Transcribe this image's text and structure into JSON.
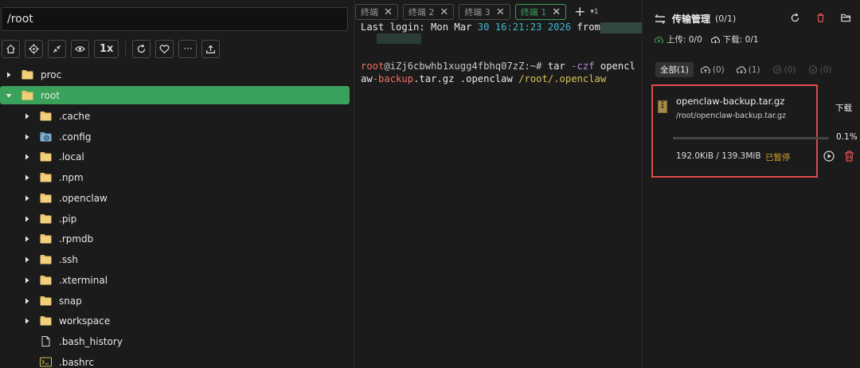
{
  "explorer": {
    "path_value": "/root",
    "zoom_label": "1x",
    "more_label": "···",
    "items": [
      {
        "name": "proc",
        "type": "folder",
        "expanded": false,
        "depth": 0
      },
      {
        "name": "root",
        "type": "folder",
        "expanded": true,
        "depth": 0,
        "selected": true
      },
      {
        "name": ".cache",
        "type": "folder",
        "depth": 1
      },
      {
        "name": ".config",
        "type": "folder-gear",
        "depth": 1
      },
      {
        "name": ".local",
        "type": "folder",
        "depth": 1
      },
      {
        "name": ".npm",
        "type": "folder",
        "depth": 1
      },
      {
        "name": ".openclaw",
        "type": "folder",
        "depth": 1
      },
      {
        "name": ".pip",
        "type": "folder",
        "depth": 1
      },
      {
        "name": ".rpmdb",
        "type": "folder",
        "depth": 1
      },
      {
        "name": ".ssh",
        "type": "folder",
        "depth": 1
      },
      {
        "name": ".xterminal",
        "type": "folder",
        "depth": 1
      },
      {
        "name": "snap",
        "type": "folder",
        "depth": 1
      },
      {
        "name": "workspace",
        "type": "folder",
        "depth": 1
      },
      {
        "name": ".bash_history",
        "type": "file",
        "depth": 1
      },
      {
        "name": ".bashrc",
        "type": "file-terminal",
        "depth": 1
      }
    ]
  },
  "terminal": {
    "tabs": [
      {
        "label": "终端 2",
        "active": false
      },
      {
        "label": "终端 3",
        "active": false
      },
      {
        "label": "终端 1",
        "active": true
      }
    ],
    "partial_tab_label": "终端",
    "tab_count_label": "1",
    "lines": {
      "login_prefix": "Last login: Mon Mar ",
      "login_day": "30",
      "login_time": "16:21:23",
      "login_year": "2026",
      "login_from": " from",
      "prompt_user": "root",
      "prompt_host": "@iZj6cbwhb1xugg4fbhq07zZ:~#",
      "cmd_tar": " tar",
      "cmd_flag": " -czf",
      "cmd_arg1_a": " opencl",
      "cmd_arg1_b": "aw",
      "cmd_arg1_c": "-backup",
      "cmd_arg1_d": ".tar.gz",
      "cmd_arg2": " .openclaw",
      "cmd_arg3_a": " /root/",
      "cmd_arg3_b": ".openclaw"
    }
  },
  "transfer": {
    "title": "传输管理",
    "count": "(0/1)",
    "upload_stat": "上传: 0/0",
    "download_stat": "下载: 0/1",
    "filters": [
      {
        "label": "全部",
        "count": "(1)",
        "active": true
      },
      {
        "label": "",
        "count": "(0)",
        "icon": "upload-cloud-icon"
      },
      {
        "label": "",
        "count": "(1)",
        "icon": "download-cloud-icon"
      },
      {
        "label": "",
        "count": "(0)",
        "icon": "pause-circle-icon"
      },
      {
        "label": "",
        "count": "(0)",
        "icon": "check-circle-icon"
      }
    ],
    "item": {
      "filename": "openclaw-backup.tar.gz",
      "path": "/root/openclaw-backup.tar.gz",
      "direction": "下载",
      "progress_label": "0.1%",
      "progress_fraction": 0.001,
      "size": "192.0KiB / 139.3MiB",
      "status": "已暂停"
    },
    "colors": {
      "accent": "#3aa15a",
      "highlight": "#e04a4a",
      "paused": "#d6a02c",
      "danger": "#e05050"
    }
  }
}
